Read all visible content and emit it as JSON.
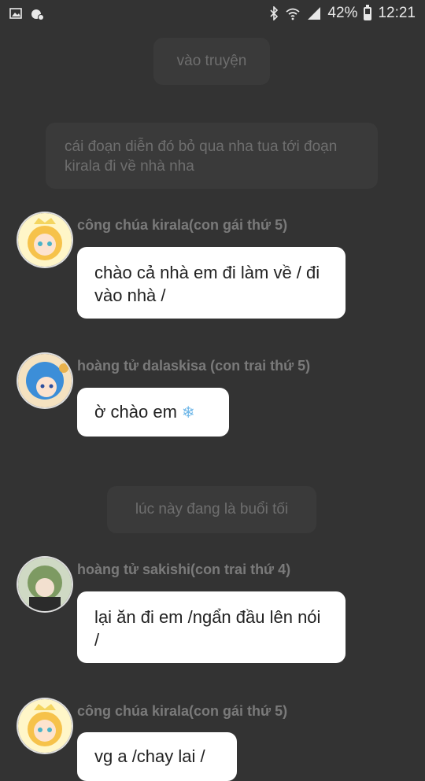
{
  "status_bar": {
    "battery_percent": "42%",
    "battery_level": 0.42,
    "time": "12:21",
    "icons": [
      "image-icon",
      "notification-icon",
      "bluetooth-icon",
      "wifi-icon",
      "signal-icon",
      "battery-icon"
    ]
  },
  "system_messages": [
    "vào truyện",
    "cái đoạn diễn đó bỏ qua nha tua tới đoạn kirala đi về nhà nha",
    "lúc này đang là buổi tối"
  ],
  "messages": [
    {
      "name": "công chúa kirala(con gái thứ 5)",
      "text": "chào cả nhà em đi làm  về / đi vào nhà /"
    },
    {
      "name": "hoàng tử dalaskisa (con trai thứ 5)",
      "text": "ờ chào em",
      "emoji": "❄"
    },
    {
      "name": "hoàng tử sakishi(con trai thứ 4)",
      "text": "lại ăn đi em /ngẩn đầu lên nói /"
    },
    {
      "name": "công chúa kirala(con gái thứ 5)",
      "text": "vg a /chay lai /"
    }
  ],
  "colors": {
    "background": "#333333",
    "system_bubble": "#3a3a3a",
    "bubble": "#ffffff"
  }
}
